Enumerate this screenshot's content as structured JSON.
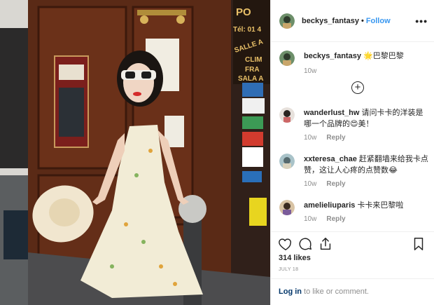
{
  "header": {
    "username": "beckys_fantasy",
    "separator": "•",
    "follow_label": "Follow",
    "more_label": "•••"
  },
  "caption": {
    "username": "beckys_fantasy",
    "text": "🌟巴黎巴黎",
    "time": "10w",
    "load_more_label": "+"
  },
  "comments": [
    {
      "username": "wanderlust_hw",
      "text": "请问卡卡的洋装是哪一个品牌的😍美！",
      "time": "10w",
      "reply_label": "Reply"
    },
    {
      "username": "xxteresa_chae",
      "text": "赶紧翻墙来给我卡点赞，这让人心疼的点赞数😂",
      "time": "10w",
      "reply_label": "Reply"
    },
    {
      "username": "amelieliuparis",
      "text": "卡卡来巴黎啦",
      "time": "10w",
      "reply_label": "Reply"
    }
  ],
  "actions": {
    "like_icon": "heart-icon",
    "comment_icon": "comment-bubble-icon",
    "share_icon": "share-icon",
    "save_icon": "bookmark-icon"
  },
  "likes_text": "314 likes",
  "date_text": "JULY 18",
  "login": {
    "link_label": "Log in",
    "suffix": " to like or comment."
  },
  "photo_signage": {
    "top_sign": "PO",
    "phone": "Tél: 01 4",
    "line1": "SALLE A",
    "line2": "CLIM",
    "line3": "FRA",
    "line4": "SALA A"
  },
  "colors": {
    "follow_blue": "#3897f0",
    "login_navy": "#003569",
    "meta_gray": "#8e8e8e",
    "door_brown": "#5a2a16"
  }
}
